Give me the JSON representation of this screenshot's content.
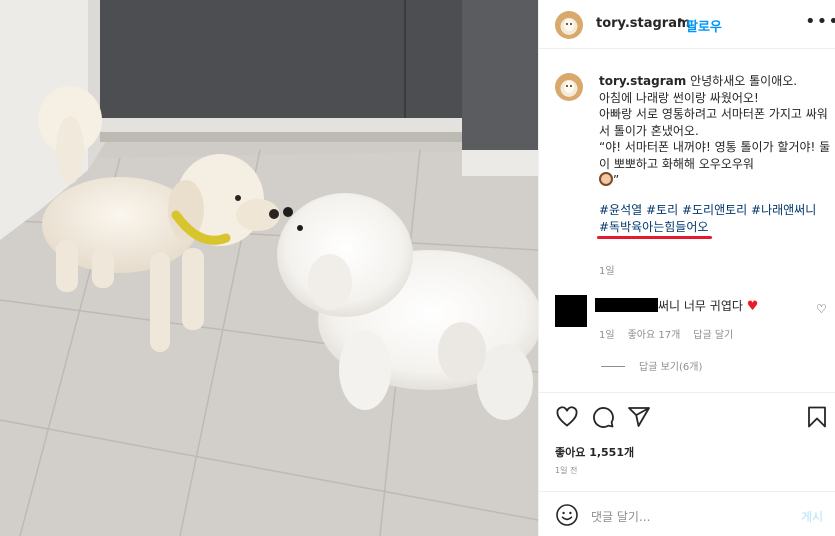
{
  "post": {
    "username": "tory.stagram",
    "follow_label": "팔로우",
    "more_icon": "more-horizontal-icon",
    "separator": "•"
  },
  "caption": {
    "username": "tory.stagram",
    "lines": [
      "안녕하새오 톨이애오.",
      "아침에 나래랑 썬이랑 싸웠어오!",
      "아빠랑 서로 영통하려고 서마터폰 가지고 싸워서 톨이가 혼냈어오.",
      "“야! 서마터폰 내꺼야! 영통 톨이가 할거야! 둘이 뽀뽀하고 화해해 오우오우워"
    ],
    "closing": "”",
    "emoji": "dog-face-emoji",
    "hashtags": "#윤석열 #토리 #도리앤토리 #나래앤써니",
    "hashtag_underlined": "#독박육아는힘들어오",
    "time": "1일"
  },
  "comment": {
    "text": "써니 너무 귀엽다",
    "likes": "좋아요 17개",
    "reply": "답글 달기",
    "time": "1일",
    "view_replies": "답글 보기(6개)"
  },
  "footer": {
    "likes": "좋아요 1,551개",
    "time_ago": "1일 전",
    "comment_placeholder": "댓글 달기...",
    "post_button": "게시"
  },
  "colors": {
    "link_blue": "#0095f6",
    "hashtag_blue": "#00376b",
    "underline_red": "#e41b2c",
    "heart_red": "#ed1c24",
    "muted": "#8e8e8e"
  }
}
